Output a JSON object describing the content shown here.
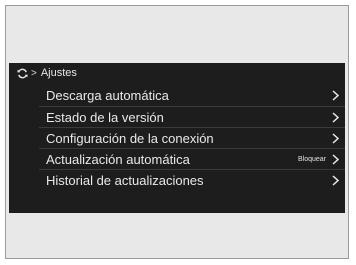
{
  "breadcrumb": {
    "icon": "sync-icon",
    "separator": ">",
    "title": "Ajustes"
  },
  "menu": {
    "items": [
      {
        "label": "Descarga automática"
      },
      {
        "label": "Estado de la versión"
      },
      {
        "label": "Configuración de la conexión"
      },
      {
        "label": "Actualización automática",
        "badge": "Bloquear"
      },
      {
        "label": "Historial de actualizaciones"
      }
    ]
  },
  "colors": {
    "screen_bg": "#1d1d1d",
    "text": "#e9e9e9",
    "frame_bg": "#e8e8e8"
  }
}
